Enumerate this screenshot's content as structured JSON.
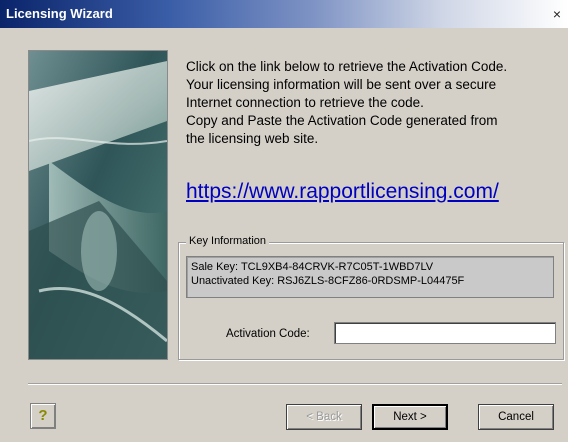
{
  "window": {
    "title": "Licensing Wizard",
    "close_glyph": "×"
  },
  "instructions": {
    "lines": [
      "Click on the link below to retrieve the Activation Code.",
      "Your licensing information will be sent over a secure",
      "Internet connection to retrieve the code.",
      "Copy and Paste the Activation Code generated from",
      "the licensing web site."
    ]
  },
  "link": {
    "text": "https://www.rapportlicensing.com/"
  },
  "key_information": {
    "legend": "Key Information",
    "sale_key": "Sale Key: TCL9XB4-84CRVK-R7C05T-1WBD7LV",
    "unactivated_key": "Unactivated Key: RSJ6ZLS-8CFZ86-0RDSMP-L04475F"
  },
  "activation": {
    "label": "Activation Code:",
    "value": "",
    "placeholder": ""
  },
  "buttons": {
    "help_glyph": "?",
    "back": "< Back",
    "next": "Next >",
    "cancel": "Cancel"
  },
  "colors": {
    "title_bar_start": "#0a246a",
    "link": "#0000c0",
    "dialog_background": "#d4d0c8"
  },
  "icons": {
    "help": "help-icon",
    "close": "close-icon"
  }
}
